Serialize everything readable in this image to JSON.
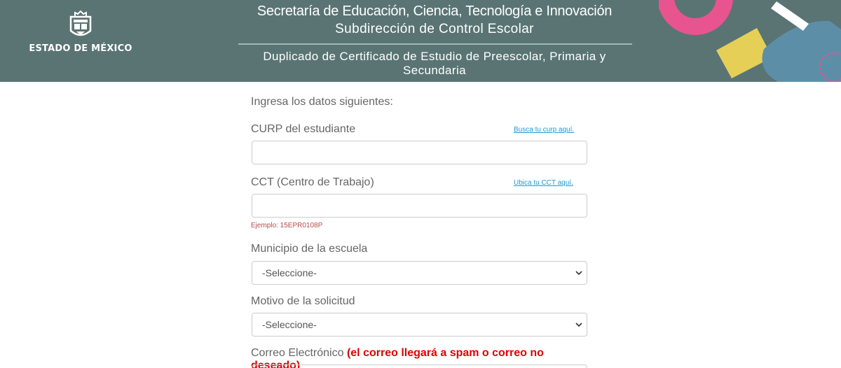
{
  "header": {
    "logo": {
      "icon": "coat-of-arms-icon",
      "text": "ESTADO DE MÉXICO"
    },
    "title_line1": "Secretaría de Educación, Ciencia, Tecnología e Innovación",
    "title_line2": "Subdirección de Control Escolar",
    "title_line3": "Duplicado de Certificado de Estudio de Preescolar, Primaria y Secundaria",
    "background_color": "#5a7474",
    "decoration_colors": [
      "#e8548f",
      "#e6cf57",
      "#5d8ea8",
      "#ffffff"
    ]
  },
  "form": {
    "intro": "Ingresa los datos siguientes:",
    "curp": {
      "label": "CURP del estudiante",
      "link": "Busca tu curp aquí.",
      "value": ""
    },
    "cct": {
      "label": "CCT (Centro de Trabajo)",
      "link": "Ubica tu CCT aquí.",
      "value": "",
      "example": "Ejemplo: 15EPR0108P"
    },
    "municipio": {
      "label": "Municipio de la escuela",
      "selected": "-Seleccione-"
    },
    "motivo": {
      "label": "Motivo de la solicitud",
      "selected": "-Seleccione-"
    },
    "correo": {
      "label": "Correo Electrónico",
      "warning": "(el correo llegará a spam o correo no deseado)"
    },
    "link_color": "#1a9bd7",
    "warning_color": "#e00000",
    "example_color": "#b94a48"
  }
}
